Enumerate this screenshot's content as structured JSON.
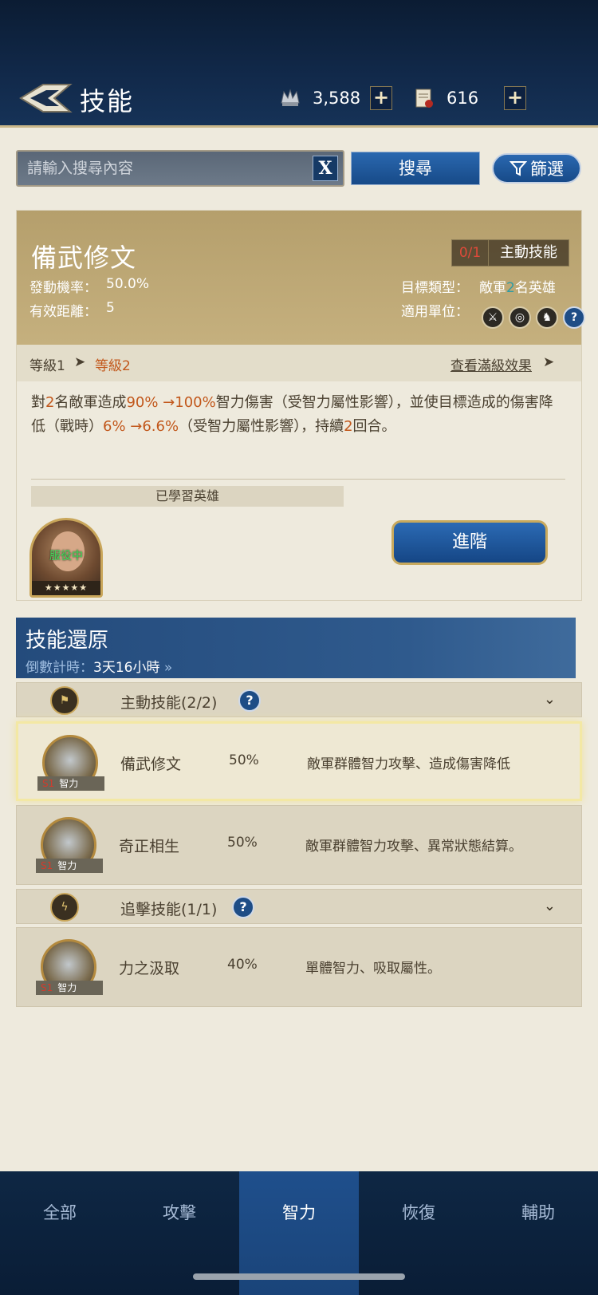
{
  "header": {
    "title": "技能",
    "resource_1_value": "3,588",
    "resource_2_value": "616",
    "plus_label": "+"
  },
  "search": {
    "placeholder": "請輸入搜尋內容",
    "clear_label": "X",
    "search_label": "搜尋",
    "filter_label": "篩選"
  },
  "skill_detail": {
    "name": "備武修文",
    "type_count": "0/1",
    "type_label": "主動技能",
    "trigger_label": "發動機率：",
    "trigger_value": "50.0%",
    "range_label": "有效距離：",
    "range_value": "5",
    "target_label": "目標類型：",
    "target_prefix": "敵軍",
    "target_num": "2",
    "target_suffix": "名英雄",
    "units_label": "適用單位：",
    "unit_icons": [
      "sword-icon",
      "target-icon",
      "horse-icon",
      "help-icon"
    ],
    "level_1": "等級1",
    "level_2": "等級2",
    "view_max": "查看滿級效果",
    "desc": {
      "p1": "對",
      "n1": "2",
      "p2": "名敵軍造成",
      "n2": "90% →100%",
      "p3": "智力傷害（受智力屬性影響），並使目標造成的傷害降低（戰時）",
      "n3": "6% →6.6%",
      "p4": "（受智力屬性影響），持續",
      "n4": "2",
      "p5": "回合。"
    },
    "learned_label": "已學習英雄",
    "hero_status": "服役中",
    "hero_stars": "★★★★★",
    "advance_label": "進階"
  },
  "restore": {
    "title": "技能還原",
    "countdown_label": "倒數計時：",
    "countdown_value": "3天16小時",
    "countdown_arrow": "»"
  },
  "sections": [
    {
      "title": "主動技能(2/2)",
      "help": "?",
      "chevron": "⌄",
      "items": [
        {
          "name": "備武修文",
          "percent": "50%",
          "desc": "敵軍群體智力攻擊、造成傷害降低",
          "tag": "智力",
          "tag_prefix": "S1"
        },
        {
          "name": "奇正相生",
          "percent": "50%",
          "desc": "敵軍群體智力攻擊、異常狀態結算。",
          "tag": "智力",
          "tag_prefix": "S1"
        }
      ]
    },
    {
      "title": "追擊技能(1/1)",
      "help": "?",
      "chevron": "⌄",
      "items": [
        {
          "name": "力之汲取",
          "percent": "40%",
          "desc": "單體智力、吸取屬性。",
          "tag": "智力",
          "tag_prefix": "S1"
        }
      ]
    }
  ],
  "bottom_nav": [
    "全部",
    "攻擊",
    "智力",
    "恢復",
    "輔助"
  ],
  "active_tab": "智力",
  "colors": {
    "accent_blue": "#174a88",
    "gold": "#c9a65a",
    "highlight_orange": "#c2581c",
    "highlight_teal": "#2d9ca6"
  }
}
